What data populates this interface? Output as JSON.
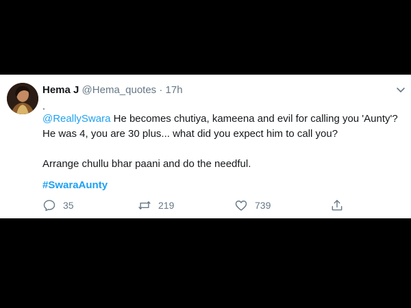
{
  "tweet": {
    "display_name": "Hema J",
    "handle": "@Hema_quotes",
    "separator": "·",
    "time": "17h",
    "leading_dot": ".",
    "mention": "@ReallySwara",
    "line1_rest": " He becomes chutiya, kameena and evil for calling you 'Aunty'?",
    "line2": "He was 4, you are 30 plus... what did you expect him to call you?",
    "paragraph2": "Arrange chullu bhar paani and do the needful.",
    "hashtag": "#SwaraAunty"
  },
  "actions": {
    "reply_count": "35",
    "retweet_count": "219",
    "like_count": "739"
  },
  "icons": {
    "reply": "reply-icon",
    "retweet": "retweet-icon",
    "like": "heart-icon",
    "share": "share-icon",
    "menu": "chevron-down-icon"
  },
  "colors": {
    "link": "#1da1f2",
    "text": "#14171a",
    "muted": "#657786",
    "frame": "#000000"
  }
}
